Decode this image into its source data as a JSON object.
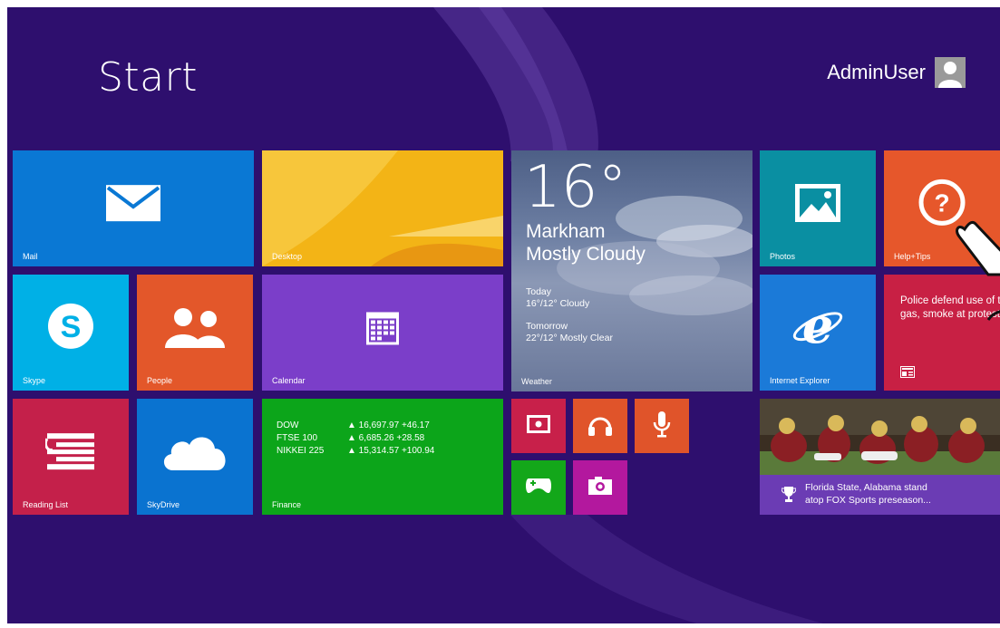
{
  "start": {
    "title": "Start"
  },
  "user": {
    "name": "AdminUser",
    "icon": "user-avatar-icon"
  },
  "tiles": {
    "mail": {
      "label": "Mail",
      "color": "#0a78d4",
      "icon": "mail-icon"
    },
    "desktop": {
      "label": "Desktop",
      "color": "#f3b416"
    },
    "weather": {
      "label": "Weather",
      "temperature": "16°",
      "city": "Markham",
      "condition": "Mostly Cloudy",
      "today_label": "Today",
      "today_forecast": "16°/12° Cloudy",
      "tomorrow_label": "Tomorrow",
      "tomorrow_forecast": "22°/12° Mostly Clear"
    },
    "photos": {
      "label": "Photos",
      "color": "#0a8fa2",
      "icon": "photo-icon"
    },
    "help": {
      "label": "Help+Tips",
      "color": "#e6572b",
      "icon": "question-icon"
    },
    "skype": {
      "label": "Skype",
      "color": "#00b0e6",
      "icon": "skype-icon"
    },
    "people": {
      "label": "People",
      "color": "#e3572a",
      "icon": "people-icon"
    },
    "calendar": {
      "label": "Calendar",
      "color": "#7b3ec9",
      "icon": "calendar-icon"
    },
    "ie": {
      "label": "Internet Explorer",
      "color": "#1b7ad8",
      "icon": "ie-icon"
    },
    "news": {
      "headline": "Police defend use of tear gas, smoke at protests",
      "color": "#c82044",
      "icon": "news-icon"
    },
    "reading": {
      "label": "Reading List",
      "color": "#c4204a",
      "icon": "reading-list-icon"
    },
    "skydrive": {
      "label": "SkyDrive",
      "color": "#0a73d0",
      "icon": "cloud-icon"
    },
    "finance": {
      "label": "Finance",
      "color": "#0ca51a",
      "rows": [
        {
          "name": "DOW",
          "value": "▲ 16,697.97 +46.17"
        },
        {
          "name": "FTSE 100",
          "value": "▲ 6,685.26 +28.58"
        },
        {
          "name": "NIKKEI 225",
          "value": "▲ 15,314.57 +100.94"
        }
      ]
    },
    "video": {
      "color": "#c8204a",
      "icon": "video-icon"
    },
    "music": {
      "color": "#e0542a",
      "icon": "headphones-icon"
    },
    "voice": {
      "color": "#e0542a",
      "icon": "microphone-icon"
    },
    "games": {
      "color": "#13a71a",
      "icon": "gamepad-icon"
    },
    "camera": {
      "color": "#b3189e",
      "icon": "camera-icon"
    },
    "sports": {
      "headline_line1": "Florida State, Alabama stand",
      "headline_line2": "atop FOX Sports preseason...",
      "icon": "trophy-icon"
    }
  }
}
